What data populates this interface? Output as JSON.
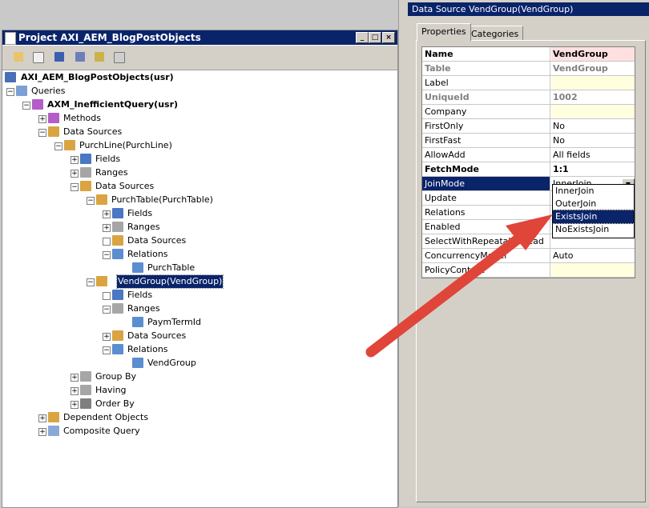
{
  "project_window": {
    "title": "Project AXI_AEM_BlogPostObjects",
    "buttons": [
      "minimize",
      "maximize",
      "close"
    ]
  },
  "toolbar": {
    "icons": [
      "open-icon",
      "properties-icon",
      "save-icon",
      "compile-icon",
      "filter-icon",
      "grid-icon"
    ]
  },
  "tree": {
    "root": "AXI_AEM_BlogPostObjects(usr)",
    "queries": "Queries",
    "query": "AXM_InefficientQuery(usr)",
    "methods": "Methods",
    "data_sources": "Data Sources",
    "purchline": "PurchLine(PurchLine)",
    "fields": "Fields",
    "ranges": "Ranges",
    "purchtable": "PurchTable(PurchTable)",
    "relations": "Relations",
    "purchtable_rel": "PurchTable",
    "vendgroup": "VendGroup(VendGroup)",
    "paymtermid": "PaymTermId",
    "vendgroup_rel": "VendGroup",
    "group_by": "Group By",
    "having": "Having",
    "order_by": "Order By",
    "dependent_objects": "Dependent Objects",
    "composite_query": "Composite Query"
  },
  "properties_window": {
    "title": "Data Source VendGroup(VendGroup)",
    "tabs": [
      "Properties",
      "Categories"
    ],
    "rows": [
      {
        "name": "Name",
        "value": "VendGroup"
      },
      {
        "name": "Table",
        "value": "VendGroup"
      },
      {
        "name": "Label",
        "value": ""
      },
      {
        "name": "UniqueId",
        "value": "1002"
      },
      {
        "name": "Company",
        "value": ""
      },
      {
        "name": "FirstOnly",
        "value": "No"
      },
      {
        "name": "FirstFast",
        "value": "No"
      },
      {
        "name": "AllowAdd",
        "value": "All fields"
      },
      {
        "name": "FetchMode",
        "value": "1:1"
      },
      {
        "name": "JoinMode",
        "value": "InnerJoin"
      },
      {
        "name": "Update",
        "value": ""
      },
      {
        "name": "Relations",
        "value": ""
      },
      {
        "name": "Enabled",
        "value": ""
      },
      {
        "name": "SelectWithRepeatableRead",
        "value": ""
      },
      {
        "name": "ConcurrencyModel",
        "value": "Auto"
      },
      {
        "name": "PolicyContext",
        "value": ""
      }
    ],
    "dropdown_options": [
      "InnerJoin",
      "OuterJoin",
      "ExistsJoin",
      "NoExistsJoin"
    ],
    "dropdown_selected": "ExistsJoin"
  },
  "colors": {
    "title_bar": "#0a246a",
    "annotation_arrow": "#e0453a"
  }
}
